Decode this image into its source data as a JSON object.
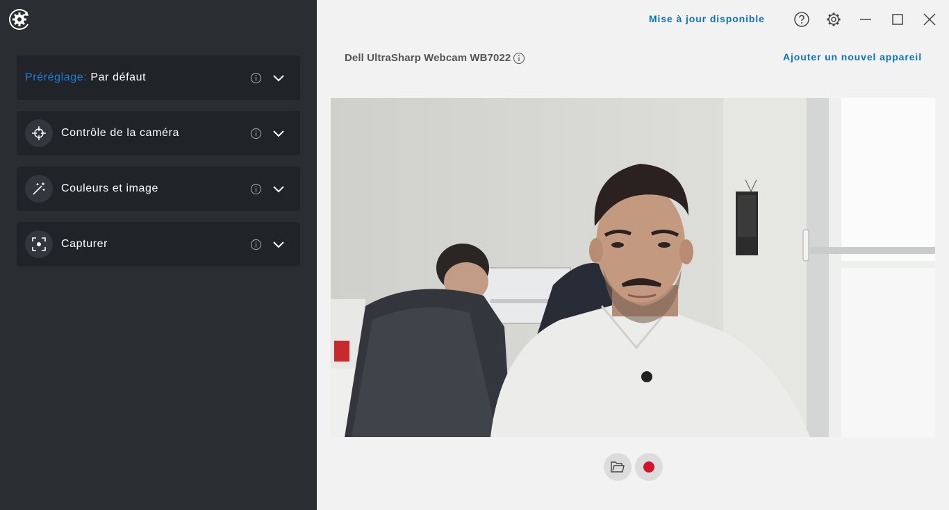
{
  "sidebar": {
    "preset": {
      "label": "Préréglage:",
      "value": "Par défaut"
    },
    "panels": [
      {
        "label": "Contrôle de la caméra",
        "icon": "crosshair-icon"
      },
      {
        "label": "Couleurs et image",
        "icon": "magic-wand-icon"
      },
      {
        "label": "Capturer",
        "icon": "capture-icon"
      }
    ]
  },
  "header": {
    "update_label": "Mise à jour disponible",
    "icons": [
      "help-icon",
      "settings-icon",
      "minimize-icon",
      "maximize-icon",
      "close-icon"
    ]
  },
  "device": {
    "name": "Dell UltraSharp Webcam WB7022",
    "add_label": "Ajouter un nouvel appareil"
  },
  "controls": {
    "buttons": [
      "folder-icon",
      "record-icon"
    ]
  },
  "colors": {
    "sidebar_bg": "#2a2d32",
    "panel_bg": "#202328",
    "accent": "#0a72c9",
    "record": "#d0142c"
  }
}
